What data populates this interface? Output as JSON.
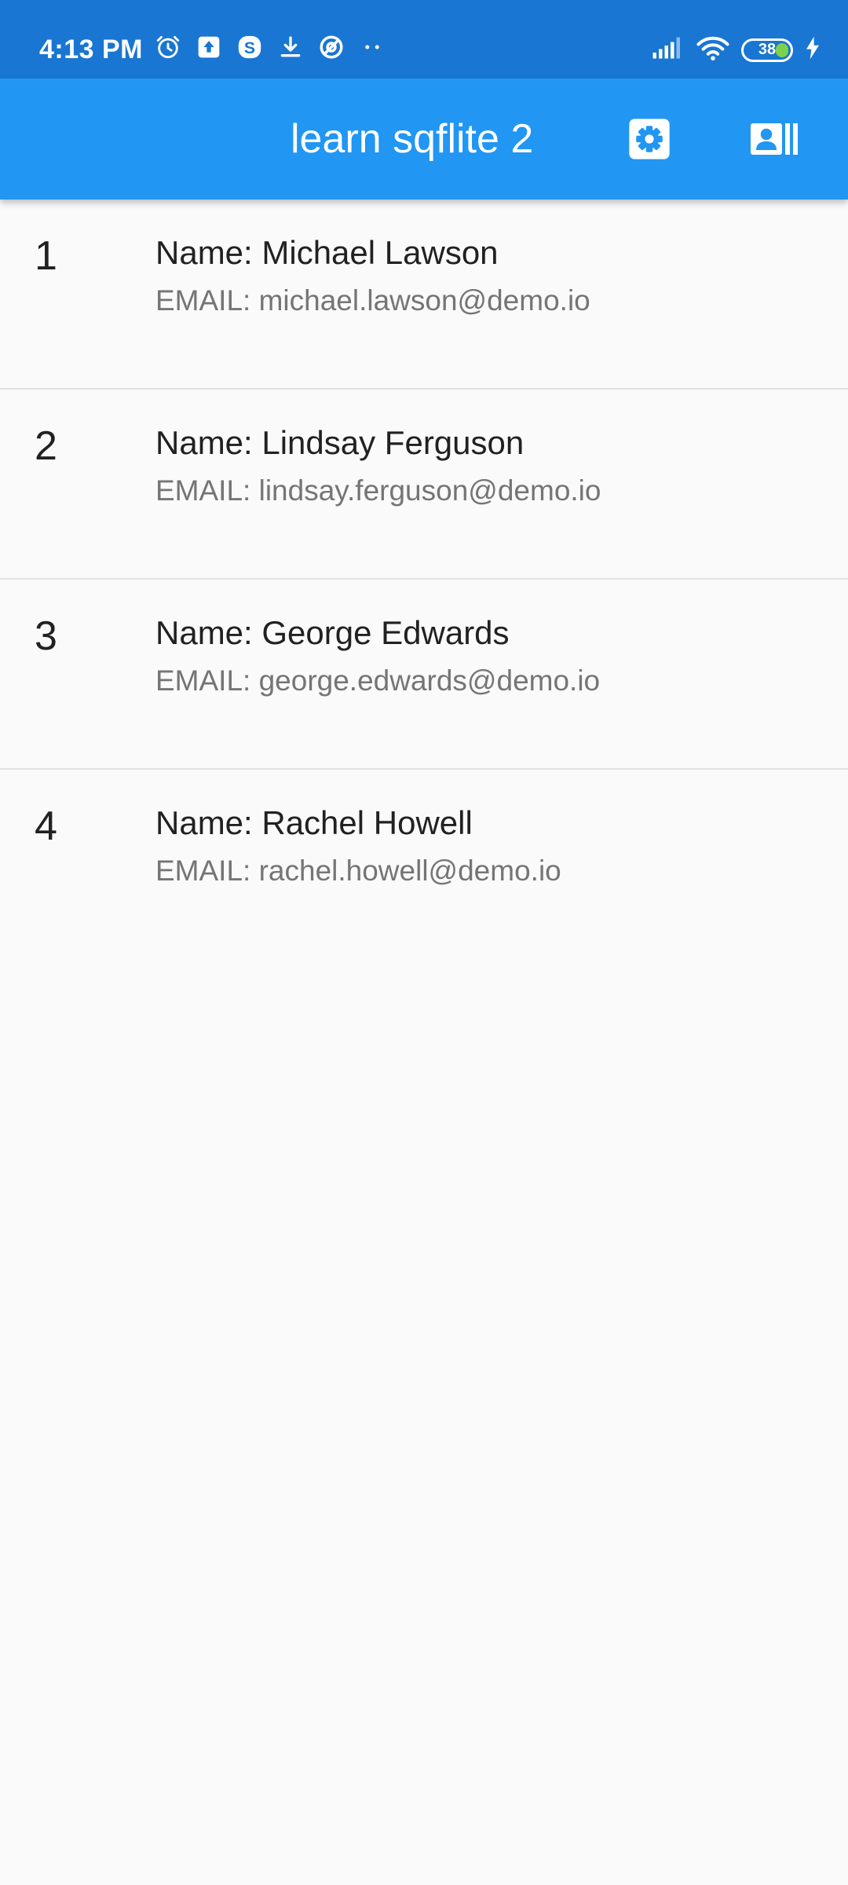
{
  "status_bar": {
    "time": "4:13 PM",
    "battery": "38",
    "icons_left": [
      "alarm-icon",
      "upload-icon",
      "skype-icon",
      "download-icon",
      "vpn-icon",
      "more-dots-icon"
    ],
    "icons_right": [
      "signal-icon",
      "wifi-icon",
      "battery-icon",
      "charging-icon"
    ]
  },
  "app_bar": {
    "title": "learn sqflite 2",
    "actions": [
      "settings-icon",
      "contacts-icon"
    ],
    "color": "#2196f3"
  },
  "users": [
    {
      "id": "1",
      "name": "Name: Michael Lawson",
      "email": "EMAIL: michael.lawson@demo.io"
    },
    {
      "id": "2",
      "name": "Name: Lindsay Ferguson",
      "email": "EMAIL: lindsay.ferguson@demo.io"
    },
    {
      "id": "3",
      "name": "Name: George Edwards",
      "email": "EMAIL: george.edwards@demo.io"
    },
    {
      "id": "4",
      "name": "Name: Rachel Howell",
      "email": "EMAIL: rachel.howell@demo.io"
    }
  ]
}
